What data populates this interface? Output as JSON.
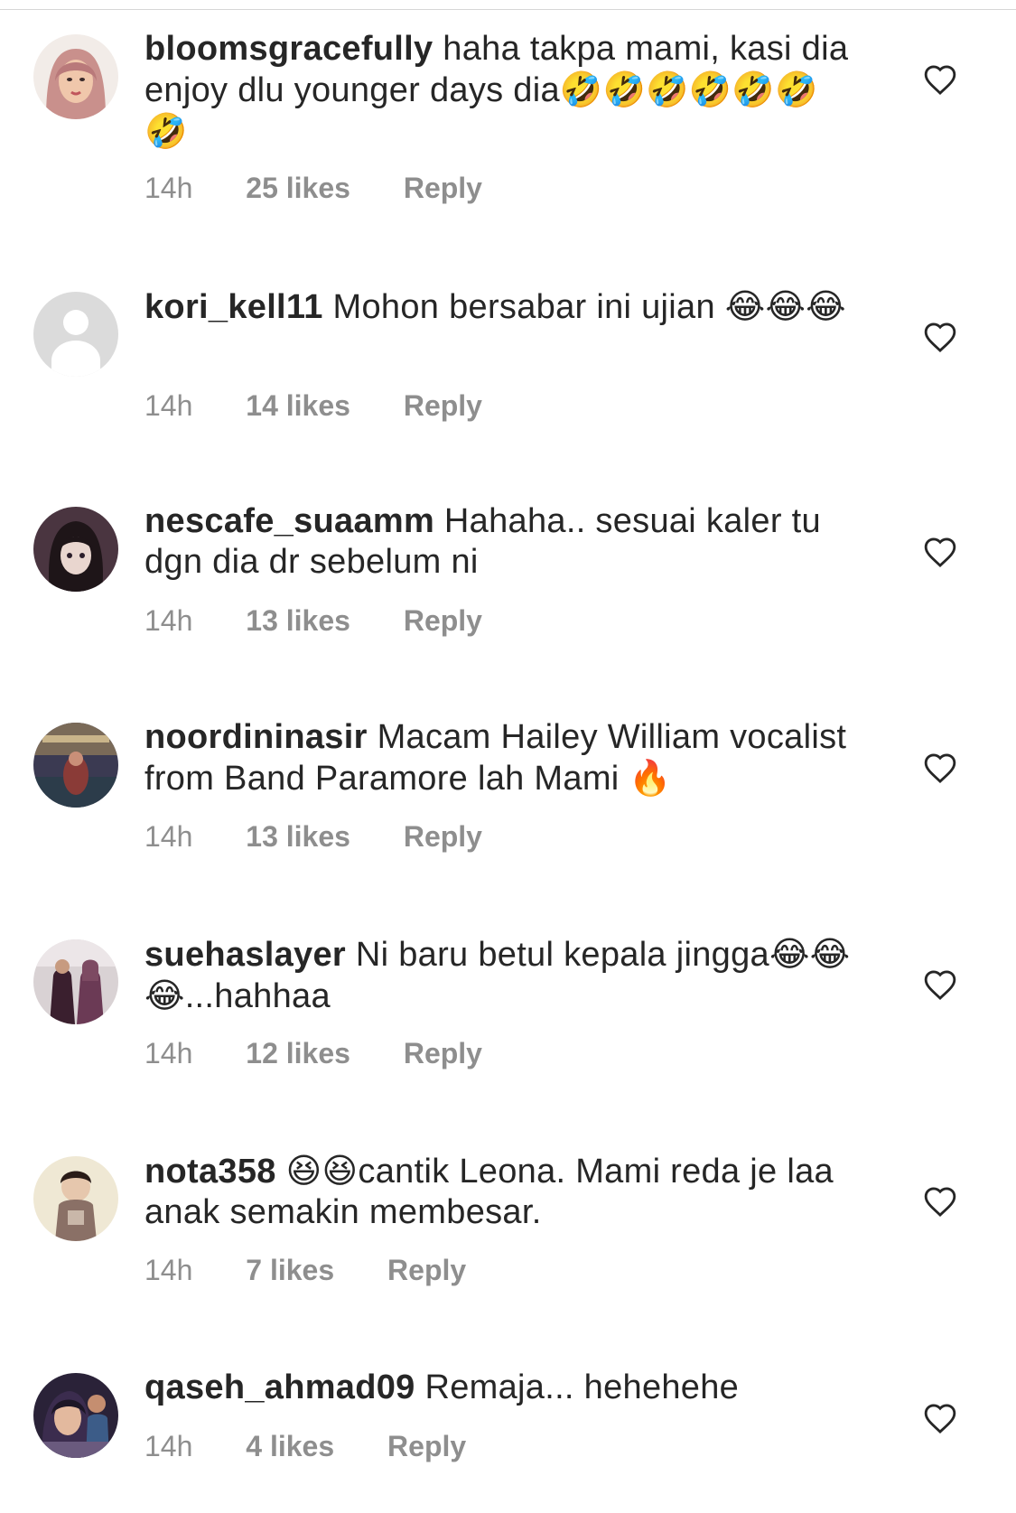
{
  "comments": [
    {
      "username": "bloomsgracefully",
      "text": "haha takpa mami, kasi dia enjoy dlu younger days dia",
      "emoji": "🤣🤣🤣🤣🤣🤣🤣",
      "time": "14h",
      "likes": "25 likes",
      "reply": "Reply",
      "avatar": "avatar-pink-hijab"
    },
    {
      "username": "kori_kell11",
      "text": "Mohon bersabar ini ujian",
      "emoji": "😂😂😂",
      "time": "14h",
      "likes": "14 likes",
      "reply": "Reply",
      "avatar": "default-avatar"
    },
    {
      "username": "nescafe_suaamm",
      "text": "Hahaha.. sesuai kaler tu dgn dia dr sebelum ni",
      "emoji": "",
      "time": "14h",
      "likes": "13 likes",
      "reply": "Reply",
      "avatar": "avatar-anime-girl"
    },
    {
      "username": "noordininasir",
      "text": "Macam Hailey William vocalist from Band Paramore lah Mami",
      "emoji": "🔥",
      "time": "14h",
      "likes": "13 likes",
      "reply": "Reply",
      "avatar": "avatar-mall-photo"
    },
    {
      "username": "suehaslayer",
      "text_before": "Ni baru betul kepala jingga",
      "emoji_mid": "😂😂😂",
      "text_after": "...hahhaa",
      "time": "14h",
      "likes": "12 likes",
      "reply": "Reply",
      "avatar": "avatar-couple"
    },
    {
      "username": "nota358",
      "emoji_lead": "😆😆",
      "text": "cantik Leona. Mami reda je laa anak semakin membesar.",
      "time": "14h",
      "likes": "7 likes",
      "reply": "Reply",
      "avatar": "avatar-baby"
    },
    {
      "username": "qaseh_ahmad09",
      "text": "Remaja... hehehehe",
      "emoji": "",
      "time": "14h",
      "likes": "4 likes",
      "reply": "Reply",
      "avatar": "avatar-selfie"
    }
  ],
  "colors": {
    "text": "#262626",
    "meta": "#8e8e8e",
    "divider": "#d6d6d6"
  },
  "icons": {
    "like": "heart-outline-icon"
  }
}
